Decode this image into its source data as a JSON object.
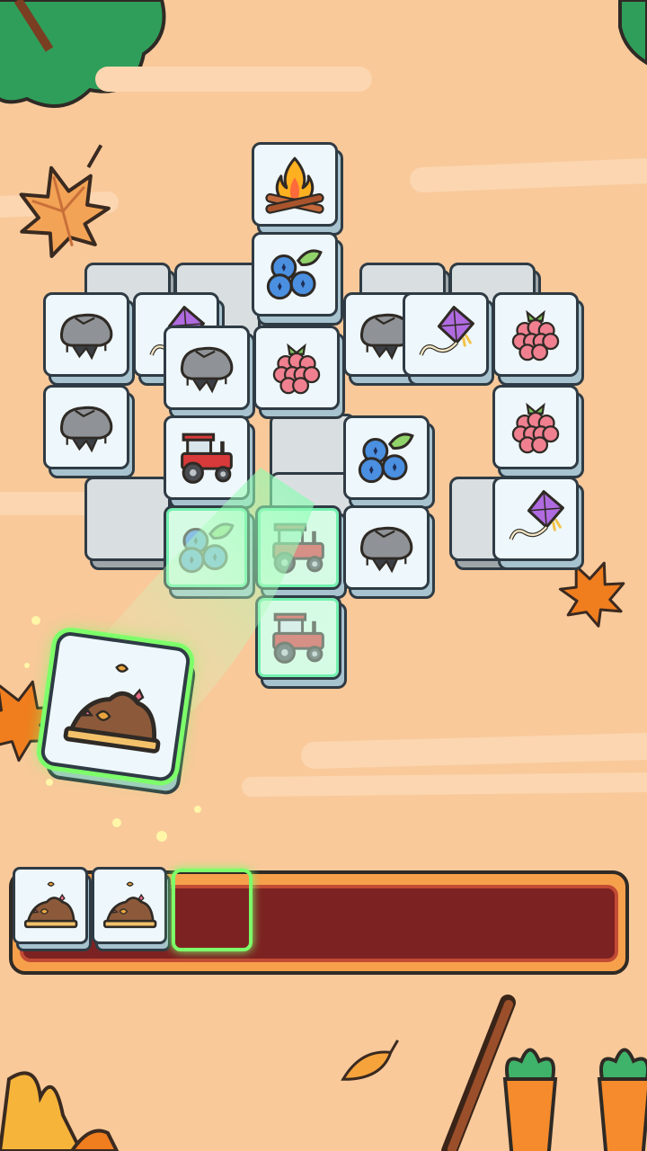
{
  "scene": {
    "background_color": "#f9c99a",
    "accent_green": "#7dff6a",
    "tray_color": "#7d2222"
  },
  "board": {
    "tiles": [
      {
        "icon": "campfire-icon"
      },
      {
        "icon": "blueberries-icon"
      },
      {
        "icon": "rock-icon"
      },
      {
        "icon": "kite-icon"
      },
      {
        "icon": "rock-icon"
      },
      {
        "icon": "kite-icon"
      },
      {
        "icon": "raspberry-icon"
      },
      {
        "icon": "rock-icon"
      },
      {
        "icon": "raspberry-icon"
      },
      {
        "icon": "rock-icon"
      },
      {
        "icon": "raspberry-icon"
      },
      {
        "icon": "tractor-icon"
      },
      {
        "icon": "blueberries-icon"
      },
      {
        "icon": "kite-icon"
      },
      {
        "icon": "blueberries-icon"
      },
      {
        "icon": "tractor-icon"
      },
      {
        "icon": "rock-icon"
      },
      {
        "icon": "tractor-icon"
      }
    ]
  },
  "selected_tile": {
    "icon": "leaf-pile-icon"
  },
  "tray": {
    "capacity": 7,
    "items": [
      {
        "icon": "leaf-pile-icon"
      },
      {
        "icon": "leaf-pile-icon"
      }
    ]
  }
}
